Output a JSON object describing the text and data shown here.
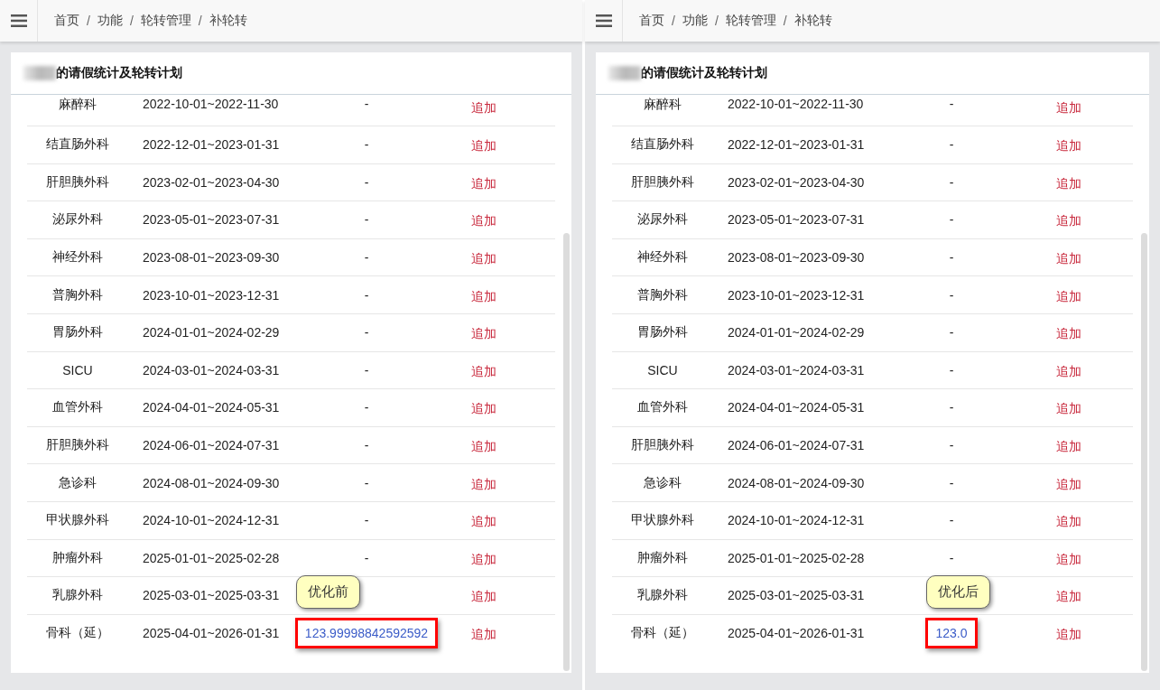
{
  "panels": [
    {
      "breadcrumb": [
        "首页",
        "功能",
        "轮转管理",
        "补轮转"
      ],
      "separator": "/",
      "title": "的请假统计及轮转计划",
      "callout": "优化前",
      "rows": [
        {
          "dept": "麻醉科",
          "period": "2022-10-01~2022-11-30",
          "value": "-",
          "action": "追加",
          "kind": "plain"
        },
        {
          "dept": "结直肠外科",
          "period": "2022-12-01~2023-01-31",
          "value": "-",
          "action": "追加",
          "kind": "plain"
        },
        {
          "dept": "肝胆胰外科",
          "period": "2023-02-01~2023-04-30",
          "value": "-",
          "action": "追加",
          "kind": "plain"
        },
        {
          "dept": "泌尿外科",
          "period": "2023-05-01~2023-07-31",
          "value": "-",
          "action": "追加",
          "kind": "plain"
        },
        {
          "dept": "神经外科",
          "period": "2023-08-01~2023-09-30",
          "value": "-",
          "action": "追加",
          "kind": "plain"
        },
        {
          "dept": "普胸外科",
          "period": "2023-10-01~2023-12-31",
          "value": "-",
          "action": "追加",
          "kind": "plain"
        },
        {
          "dept": "胃肠外科",
          "period": "2024-01-01~2024-02-29",
          "value": "-",
          "action": "追加",
          "kind": "plain"
        },
        {
          "dept": "SICU",
          "period": "2024-03-01~2024-03-31",
          "value": "-",
          "action": "追加",
          "kind": "plain"
        },
        {
          "dept": "血管外科",
          "period": "2024-04-01~2024-05-31",
          "value": "-",
          "action": "追加",
          "kind": "plain"
        },
        {
          "dept": "肝胆胰外科",
          "period": "2024-06-01~2024-07-31",
          "value": "-",
          "action": "追加",
          "kind": "plain"
        },
        {
          "dept": "急诊科",
          "period": "2024-08-01~2024-09-30",
          "value": "-",
          "action": "追加",
          "kind": "plain"
        },
        {
          "dept": "甲状腺外科",
          "period": "2024-10-01~2024-12-31",
          "value": "-",
          "action": "追加",
          "kind": "plain"
        },
        {
          "dept": "肿瘤外科",
          "period": "2025-01-01~2025-02-28",
          "value": "-",
          "action": "追加",
          "kind": "plain"
        },
        {
          "dept": "乳腺外科",
          "period": "2025-03-01~2025-03-31",
          "action": "追加",
          "kind": "plain"
        },
        {
          "dept": "骨科（延）",
          "period": "2025-04-01~2026-01-31",
          "value": "123.99998842592592",
          "action": "追加",
          "kind": "highlighted"
        }
      ]
    },
    {
      "breadcrumb": [
        "首页",
        "功能",
        "轮转管理",
        "补轮转"
      ],
      "separator": "/",
      "title": "的请假统计及轮转计划",
      "callout": "优化后",
      "rows": [
        {
          "dept": "麻醉科",
          "period": "2022-10-01~2022-11-30",
          "value": "-",
          "action": "追加",
          "kind": "plain"
        },
        {
          "dept": "结直肠外科",
          "period": "2022-12-01~2023-01-31",
          "value": "-",
          "action": "追加",
          "kind": "plain"
        },
        {
          "dept": "肝胆胰外科",
          "period": "2023-02-01~2023-04-30",
          "value": "-",
          "action": "追加",
          "kind": "plain"
        },
        {
          "dept": "泌尿外科",
          "period": "2023-05-01~2023-07-31",
          "value": "-",
          "action": "追加",
          "kind": "plain"
        },
        {
          "dept": "神经外科",
          "period": "2023-08-01~2023-09-30",
          "value": "-",
          "action": "追加",
          "kind": "plain"
        },
        {
          "dept": "普胸外科",
          "period": "2023-10-01~2023-12-31",
          "value": "-",
          "action": "追加",
          "kind": "plain"
        },
        {
          "dept": "胃肠外科",
          "period": "2024-01-01~2024-02-29",
          "value": "-",
          "action": "追加",
          "kind": "plain"
        },
        {
          "dept": "SICU",
          "period": "2024-03-01~2024-03-31",
          "value": "-",
          "action": "追加",
          "kind": "plain"
        },
        {
          "dept": "血管外科",
          "period": "2024-04-01~2024-05-31",
          "value": "-",
          "action": "追加",
          "kind": "plain"
        },
        {
          "dept": "肝胆胰外科",
          "period": "2024-06-01~2024-07-31",
          "value": "-",
          "action": "追加",
          "kind": "plain"
        },
        {
          "dept": "急诊科",
          "period": "2024-08-01~2024-09-30",
          "value": "-",
          "action": "追加",
          "kind": "plain"
        },
        {
          "dept": "甲状腺外科",
          "period": "2024-10-01~2024-12-31",
          "value": "-",
          "action": "追加",
          "kind": "plain"
        },
        {
          "dept": "肿瘤外科",
          "period": "2025-01-01~2025-02-28",
          "value": "-",
          "action": "追加",
          "kind": "plain"
        },
        {
          "dept": "乳腺外科",
          "period": "2025-03-01~2025-03-31",
          "action": "追加",
          "kind": "plain"
        },
        {
          "dept": "骨科（延）",
          "period": "2025-04-01~2026-01-31",
          "value": "123.0",
          "action": "追加",
          "kind": "highlighted"
        }
      ]
    }
  ]
}
